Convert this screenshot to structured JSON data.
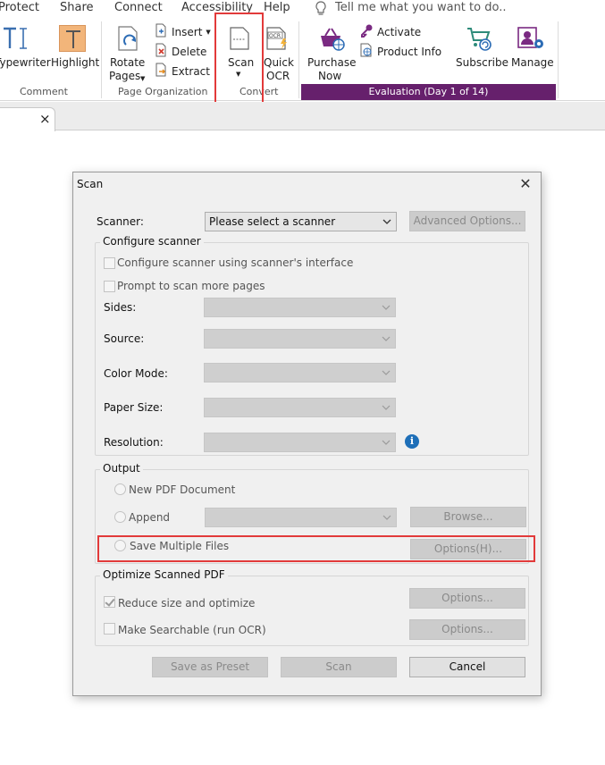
{
  "menubar": {
    "items": [
      "Protect",
      "Share",
      "Connect",
      "Accessibility",
      "Help"
    ],
    "tell_me": "Tell me what you want to do.."
  },
  "ribbon": {
    "typewriter": "Typewriter",
    "highlight": "Highlight",
    "comment_group": "Comment",
    "rotate_pages_line1": "Rotate",
    "rotate_pages_line2": "Pages",
    "insert": "Insert",
    "delete": "Delete",
    "extract": "Extract",
    "page_org_group": "Page Organization",
    "scan": "Scan",
    "quick_ocr_line1": "Quick",
    "quick_ocr_line2": "OCR",
    "convert_group": "Convert",
    "purchase_line1": "Purchase",
    "purchase_line2": "Now",
    "activate": "Activate",
    "product_info": "Product Info",
    "subscribe": "Subscribe",
    "manage": "Manage",
    "evaluation": "Evaluation (Day 1 of 14)",
    "ocr_badge": "OCR"
  },
  "doc_tab": {
    "close": "×"
  },
  "dialog": {
    "title": "Scan",
    "close": "✕",
    "scanner_label": "Scanner:",
    "scanner_value": "Please select a scanner",
    "advanced_options": "Advanced Options...",
    "configure_group": "Configure scanner",
    "configure_interface": "Configure scanner using scanner's interface",
    "prompt_more": "Prompt to scan more pages",
    "sides": "Sides:",
    "source": "Source:",
    "color_mode": "Color Mode:",
    "paper_size": "Paper Size:",
    "resolution": "Resolution:",
    "output_group": "Output",
    "new_pdf": "New PDF Document",
    "append": "Append",
    "browse": "Browse...",
    "save_multiple": "Save Multiple Files",
    "options_h": "Options(H)...",
    "optimize_group": "Optimize Scanned PDF",
    "reduce_size": "Reduce size and optimize",
    "options_1": "Options...",
    "make_searchable": "Make Searchable (run OCR)",
    "options_2": "Options...",
    "save_preset": "Save as Preset",
    "scan_button": "Scan",
    "cancel": "Cancel"
  },
  "colors": {
    "evaluation_bg": "#66206c",
    "highlight_box": "#e23a3a",
    "info_icon": "#1e6fb8"
  }
}
